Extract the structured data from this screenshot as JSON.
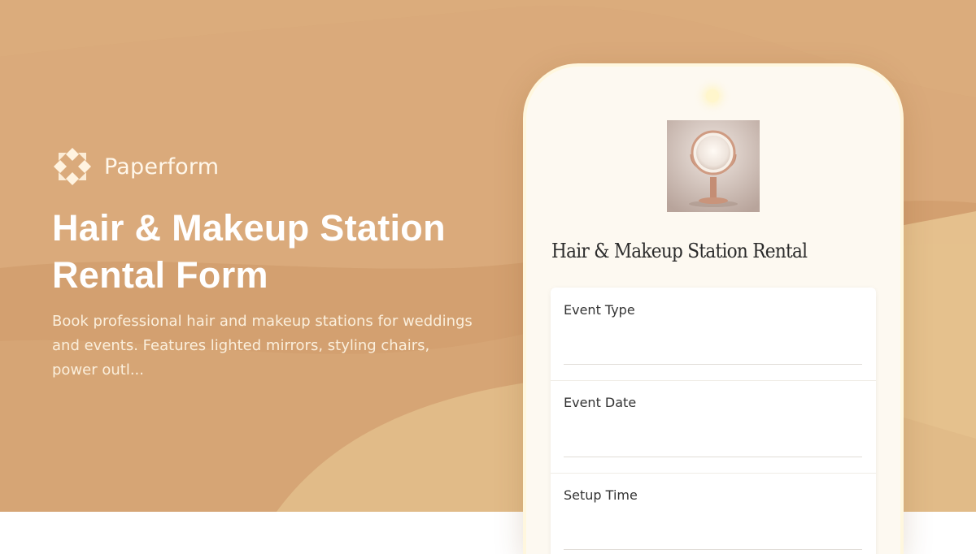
{
  "brand": {
    "name": "Paperform",
    "logo_icon": "paperform-logo-icon"
  },
  "hero": {
    "title": "Hair & Makeup Station Rental Form",
    "description": "Book professional hair and makeup stations for weddings and events. Features lighted mirrors, styling chairs, power outl..."
  },
  "phone": {
    "image_icon": "lighted-mirror-image",
    "form_title": "Hair & Makeup Station Rental",
    "fields": [
      {
        "label": "Event Type",
        "value": ""
      },
      {
        "label": "Event Date",
        "value": ""
      },
      {
        "label": "Setup Time",
        "value": ""
      }
    ]
  },
  "colors": {
    "background": "#d9a877",
    "background_light": "#e5c18f",
    "phone_screen": "#fdf9f1",
    "text_light": "#ffffff"
  }
}
